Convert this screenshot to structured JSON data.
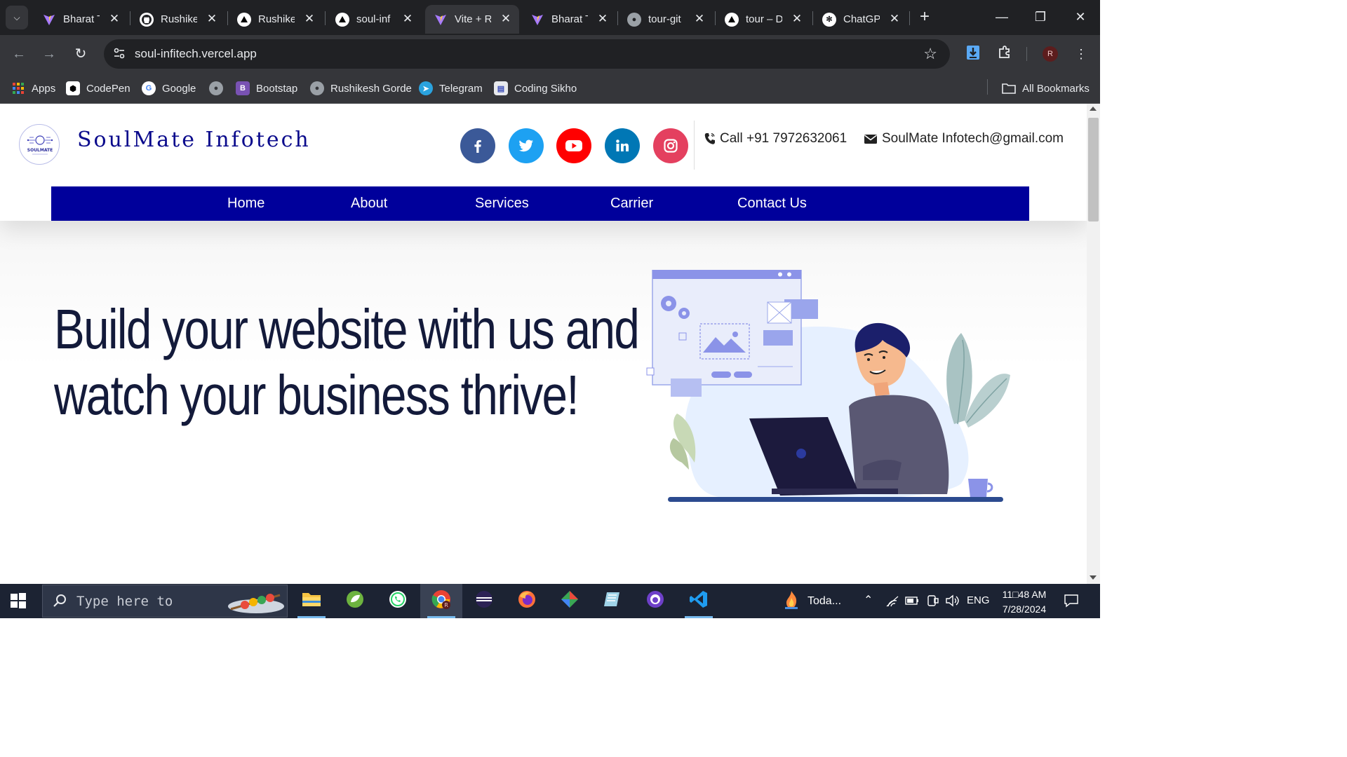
{
  "browser": {
    "tabs": [
      {
        "title": "Bharat T",
        "icon": "vite-icon",
        "active": false
      },
      {
        "title": "Rushike",
        "icon": "github-icon",
        "active": false
      },
      {
        "title": "Rushike",
        "icon": "vercel-icon",
        "active": false
      },
      {
        "title": "soul-inf",
        "icon": "vercel-icon",
        "active": false
      },
      {
        "title": "Vite + R",
        "icon": "vite-icon",
        "active": true
      },
      {
        "title": "Bharat T",
        "icon": "vite-icon",
        "active": false
      },
      {
        "title": "tour-git",
        "icon": "globe-icon",
        "active": false
      },
      {
        "title": "tour – D",
        "icon": "vercel-icon",
        "active": false
      },
      {
        "title": "ChatGP",
        "icon": "chatgpt-icon",
        "active": false
      }
    ],
    "url": "soul-infitech.vercel.app",
    "profile_initial": "R",
    "bookmarks": [
      {
        "label": "Apps",
        "icon": "apps-grid-icon"
      },
      {
        "label": "CodePen",
        "icon": "codepen-icon"
      },
      {
        "label": "Google",
        "icon": "google-icon"
      },
      {
        "label": "",
        "icon": "globe-icon"
      },
      {
        "label": "Bootstap",
        "icon": "bootstrap-icon"
      },
      {
        "label": "Rushikesh Gorde",
        "icon": "globe-icon"
      },
      {
        "label": "Telegram",
        "icon": "telegram-icon"
      },
      {
        "label": "Coding Sikho",
        "icon": "coding-sikho-icon"
      }
    ],
    "all_bookmarks": "All Bookmarks"
  },
  "site": {
    "brand": "SoulMate Infotech",
    "logo_text": "SOULMATE",
    "phone": "Call +91 7972632061",
    "email": "SoulMate Infotech@gmail.com",
    "socials": [
      {
        "name": "facebook-icon",
        "color": "#3b5998"
      },
      {
        "name": "twitter-icon",
        "color": "#1da1f2"
      },
      {
        "name": "youtube-icon",
        "color": "#ff0000"
      },
      {
        "name": "linkedin-icon",
        "color": "#0077b5"
      },
      {
        "name": "instagram-icon",
        "color": "#e4405f"
      }
    ],
    "nav": [
      "Home",
      "About",
      "Services",
      "Carrier",
      "Contact Us"
    ],
    "nav_color": "#00009b",
    "hero_line1": "Build your website with us and",
    "hero_line2": "watch your business thrive!"
  },
  "taskbar": {
    "search_placeholder": "Type here to",
    "weather": "Toda...",
    "lang": "ENG",
    "time": "11□48 AM",
    "date": "7/28/2024"
  }
}
